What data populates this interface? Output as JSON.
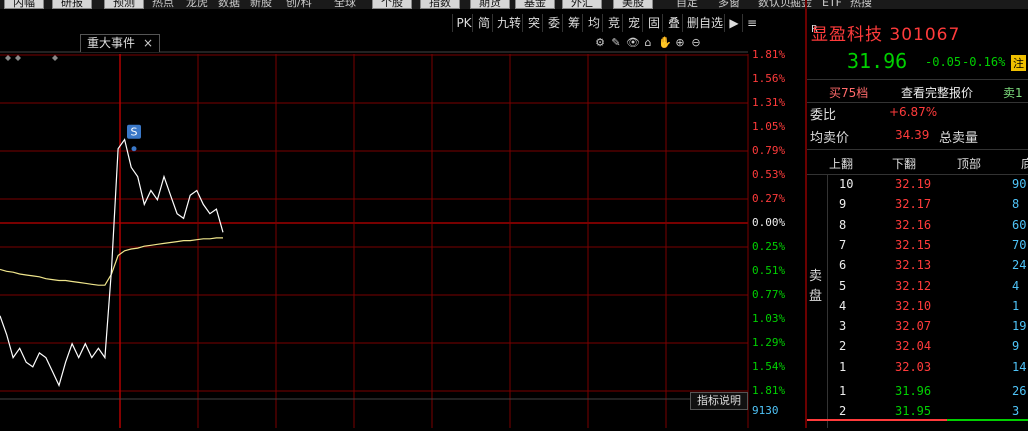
{
  "nav": {
    "items": [
      {
        "label": "内幅",
        "boxed": true
      },
      {
        "label": "研报",
        "boxed": true
      },
      {
        "label": "预测",
        "boxed": true
      },
      {
        "label": "热点",
        "boxed": false
      },
      {
        "label": "龙虎",
        "boxed": false
      },
      {
        "label": "数据",
        "boxed": false
      },
      {
        "label": "新股",
        "boxed": false
      },
      {
        "label": "创/科",
        "boxed": false
      },
      {
        "label": "全球",
        "boxed": false
      },
      {
        "label": "个股",
        "boxed": true
      },
      {
        "label": "指数",
        "boxed": true
      },
      {
        "label": "期货",
        "boxed": true
      },
      {
        "label": "基金",
        "boxed": true
      },
      {
        "label": "外汇",
        "boxed": true
      },
      {
        "label": "美股",
        "boxed": true
      },
      {
        "label": "自定",
        "boxed": false
      },
      {
        "label": "多窗",
        "boxed": false
      },
      {
        "label": "数认贝",
        "boxed": false
      },
      {
        "label": "掘金",
        "boxed": false
      },
      {
        "label": "ETF",
        "boxed": false
      },
      {
        "label": "热搜",
        "boxed": false
      }
    ]
  },
  "chart_toolbar": [
    "PK",
    "简",
    "九转",
    "突",
    "委",
    "筹",
    "均",
    "竞",
    "宠",
    "固",
    "叠",
    "删自选"
  ],
  "event_tab": {
    "label": "重大事件",
    "close": "×"
  },
  "chart_controls": [
    "⚙",
    "✎",
    "👁",
    "⌂",
    "✋",
    "⊕",
    "⊖"
  ],
  "chart_explain": "指标说明",
  "volume_label": "9130",
  "signal_marker": "S",
  "chart_data": {
    "type": "line",
    "percent_axis": [
      {
        "label": "1.81%",
        "dir": "up"
      },
      {
        "label": "1.56%",
        "dir": "up"
      },
      {
        "label": "1.31%",
        "dir": "up"
      },
      {
        "label": "1.05%",
        "dir": "up"
      },
      {
        "label": "0.79%",
        "dir": "up"
      },
      {
        "label": "0.53%",
        "dir": "up"
      },
      {
        "label": "0.27%",
        "dir": "up"
      },
      {
        "label": "0.00%",
        "dir": "flat"
      },
      {
        "label": "0.25%",
        "dir": "down"
      },
      {
        "label": "0.51%",
        "dir": "down"
      },
      {
        "label": "0.77%",
        "dir": "down"
      },
      {
        "label": "1.03%",
        "dir": "down"
      },
      {
        "label": "1.29%",
        "dir": "down"
      },
      {
        "label": "1.54%",
        "dir": "down"
      },
      {
        "label": "1.81%",
        "dir": "down"
      }
    ],
    "ylim": [
      -1.81,
      1.81
    ],
    "price_series": [
      -1.0,
      -1.2,
      -1.45,
      -1.35,
      -1.5,
      -1.55,
      -1.4,
      -1.45,
      -1.6,
      -1.75,
      -1.5,
      -1.3,
      -1.45,
      -1.3,
      -1.45,
      -1.35,
      -1.45,
      -0.5,
      0.8,
      0.9,
      0.6,
      0.5,
      0.2,
      0.35,
      0.25,
      0.5,
      0.3,
      0.1,
      0.05,
      0.3,
      0.35,
      0.2,
      0.1,
      0.15,
      -0.1
    ],
    "avg_series": [
      -0.5,
      -0.52,
      -0.53,
      -0.55,
      -0.56,
      -0.57,
      -0.58,
      -0.6,
      -0.61,
      -0.62,
      -0.62,
      -0.63,
      -0.64,
      -0.65,
      -0.66,
      -0.67,
      -0.67,
      -0.55,
      -0.35,
      -0.3,
      -0.28,
      -0.27,
      -0.25,
      -0.24,
      -0.23,
      -0.22,
      -0.21,
      -0.2,
      -0.19,
      -0.19,
      -0.18,
      -0.17,
      -0.17,
      -0.16,
      -0.16
    ],
    "colors": {
      "price": "#ffffff",
      "avg": "#f0e68c",
      "grid": "#7a0000",
      "zero": "#c00000"
    }
  },
  "quote": {
    "r_mark": "R",
    "name": "显盈科技 301067",
    "price": "31.96",
    "change": "-0.05",
    "change_pct": "-0.16%",
    "note": "注",
    "tabs": [
      "买75档",
      "查看完整报价",
      "卖1"
    ],
    "weibi_label": "委比",
    "weibi_value": "+6.87%",
    "avg_sell_label": "均卖价",
    "avg_sell_value": "34.39",
    "total_sell_label": "总卖量",
    "ob_headers": [
      "上翻",
      "下翻",
      "顶部",
      "底"
    ],
    "side_label": [
      "卖",
      "盘"
    ],
    "sell_levels": [
      {
        "lvl": "10",
        "px": "32.19",
        "vol": "90"
      },
      {
        "lvl": "9",
        "px": "32.17",
        "vol": "8"
      },
      {
        "lvl": "8",
        "px": "32.16",
        "vol": "60"
      },
      {
        "lvl": "7",
        "px": "32.15",
        "vol": "70"
      },
      {
        "lvl": "6",
        "px": "32.13",
        "vol": "24"
      },
      {
        "lvl": "5",
        "px": "32.12",
        "vol": "4"
      },
      {
        "lvl": "4",
        "px": "32.10",
        "vol": "1"
      },
      {
        "lvl": "3",
        "px": "32.07",
        "vol": "19"
      },
      {
        "lvl": "2",
        "px": "32.04",
        "vol": "9"
      },
      {
        "lvl": "1",
        "px": "32.03",
        "vol": "14"
      }
    ],
    "buy_levels": [
      {
        "lvl": "1",
        "px": "31.96",
        "vol": "26"
      },
      {
        "lvl": "2",
        "px": "31.95",
        "vol": "3"
      }
    ]
  }
}
